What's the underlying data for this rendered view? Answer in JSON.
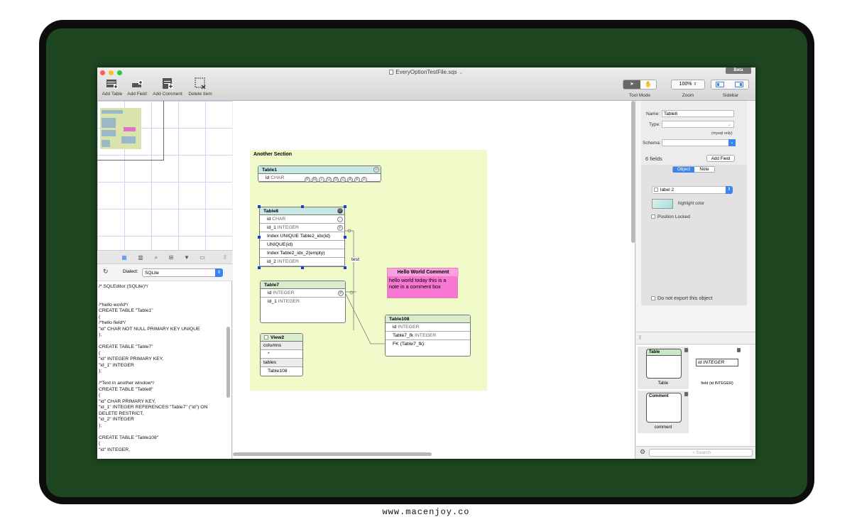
{
  "window": {
    "title": "EveryOptionTestFile.sqs",
    "badge": "Beta"
  },
  "toolbar": {
    "add_table": "Add Table",
    "add_field": "Add Field",
    "add_comment": "Add Comment",
    "delete_item": "Delete Item",
    "tool_mode": "Tool Mode",
    "zoom_value": "100%",
    "zoom": "Zoom",
    "sidebar": "Sidebar"
  },
  "left": {
    "dialect_label": "Dialect:",
    "dialect_value": "SQLite",
    "sql_lines": [
      "/* SQLEditor (SQLite)*/",
      "",
      "",
      "/*hello world*/",
      "CREATE TABLE \"Table1\"",
      "(",
      "/*hello field*/",
      "\"id\" CHAR NOT NULL PRIMARY KEY UNIQUE",
      ");",
      "",
      "CREATE TABLE \"Table7\"",
      "(",
      "\"id\" INTEGER PRIMARY KEY,",
      "\"id_1\" INTEGER",
      ");",
      "",
      "/*Text in another window*/",
      "CREATE TABLE \"Table8\"",
      "(",
      "\"id\" CHAR PRIMARY KEY,",
      "\"id_1\" INTEGER REFERENCES \"Table7\" (\"id\") ON",
      "DELETE RESTRICT,",
      "\"id_2\" INTEGER",
      ");",
      "",
      "CREATE TABLE \"Table108\"",
      "(",
      "\"id\" INTEGER,"
    ]
  },
  "canvas": {
    "section_title": "Another Section",
    "table1": {
      "name": "Table1",
      "rows": [
        {
          "name": "id",
          "type": "CHAR"
        }
      ]
    },
    "table8": {
      "name": "Table8",
      "rows": [
        {
          "name": "id",
          "type": "CHAR"
        },
        {
          "name": "id_1",
          "type": "INTEGER"
        },
        {
          "name": "Index UNIQUE Table2_idx(id)",
          "type": ""
        },
        {
          "name": "UNIQUE(id)",
          "type": ""
        },
        {
          "name": "Index Table2_idx_2(empty)",
          "type": ""
        },
        {
          "name": "id_2",
          "type": "INTEGER"
        }
      ]
    },
    "table7": {
      "name": "Table7",
      "rows": [
        {
          "name": "id",
          "type": "INTEGER"
        },
        {
          "name": "id_1",
          "type": "INTEGER"
        }
      ]
    },
    "view2": {
      "name": "View2",
      "rows": [
        "columns",
        "*",
        "tables",
        "Table108"
      ]
    },
    "table108": {
      "name": "Table108",
      "rows": [
        {
          "name": "id",
          "type": "INTEGER"
        },
        {
          "name": "Table7_fk",
          "type": "INTEGER"
        },
        {
          "name": "FK (Table7_fk)",
          "type": ""
        }
      ]
    },
    "relation_label": "test",
    "comment": {
      "title": "Hello World Comment",
      "text": "hello world  today this is a note in a comment box"
    }
  },
  "inspector": {
    "name_label": "Name:",
    "name_value": "Table8",
    "type_label": "Type:",
    "type_hint": "(mysql only)",
    "schema_label": "Schema:",
    "fields_count": "6 fields",
    "add_field": "Add Field",
    "tab_object": "Object",
    "tab_note": "Note",
    "label_select": "label 2",
    "highlight_color": "highlight color",
    "position_locked": "Position Locked",
    "do_not_export": "Do not export this object"
  },
  "library": {
    "table_head": "Table",
    "table_caption": "Table",
    "field_text": "id INTEGER",
    "field_caption": "field (id INTEGER)",
    "comment_head": "Comment",
    "comment_caption": "comment",
    "search_placeholder": "Search"
  },
  "colors": {
    "accent": "#3b84f0",
    "section": "#f0fbc9",
    "comment": "#f777d3",
    "selection": "#1b3ccf"
  },
  "footer": {
    "caption": "www.macenjoy.co"
  }
}
